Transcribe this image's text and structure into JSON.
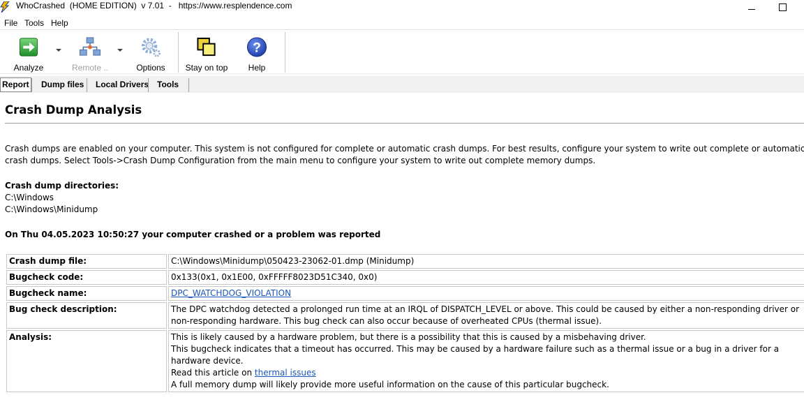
{
  "window": {
    "title": "WhoCrashed  (HOME EDITION)  v 7.01  -   https://www.resplendence.com"
  },
  "menu": [
    "File",
    "Tools",
    "Help"
  ],
  "toolbar": {
    "analyze": "Analyze",
    "remote": "Remote ..",
    "options": "Options",
    "stay_on_top": "Stay on top",
    "help": "Help"
  },
  "tabs": [
    "Report",
    "Dump files",
    "Local Drivers",
    "Tools"
  ],
  "report": {
    "heading": "Crash Dump Analysis",
    "intro": "Crash dumps are enabled on your computer. This system is not configured for complete or automatic crash dumps. For best results, configure your system to write out complete or automatic crash dumps. Select Tools->Crash Dump Configuration from the main menu to configure your system to write out complete memory dumps.",
    "dirs_title": "Crash dump directories:",
    "dirs": [
      "C:\\Windows",
      "C:\\Windows\\Minidump"
    ],
    "crash_line": "On Thu 04.05.2023 10:50:27 your computer crashed or a problem was reported",
    "table": {
      "dump_file_key": "Crash dump file:",
      "dump_file_val": "C:\\Windows\\Minidump\\050423-23062-01.dmp (Minidump)",
      "bugcheck_code_key": "Bugcheck code:",
      "bugcheck_code_val": "0x133(0x1, 0x1E00, 0xFFFFF8023D51C340, 0x0)",
      "bugcheck_name_key": "Bugcheck name:",
      "bugcheck_name_val": "DPC_WATCHDOG_VIOLATION",
      "description_key": "Bug check description:",
      "description_val": "The DPC watchdog detected a prolonged run time at an IRQL of DISPATCH_LEVEL or above. This could be caused by either a non-responding driver or non-responding hardware. This bug check can also occur because of overheated CPUs (thermal issue).",
      "analysis_key": "Analysis:",
      "analysis_line1": "This is likely caused by a hardware problem, but there is a possibility that this is caused by a misbehaving driver.",
      "analysis_line2": "This bugcheck indicates that a timeout has occurred. This may be caused by a hardware failure such as a thermal issue or a bug in a driver for a hardware device.",
      "analysis_read_prefix": "Read this article on ",
      "analysis_read_link": "thermal issues",
      "analysis_line4": "A full memory dump will likely provide more useful information on the cause of this particular bugcheck."
    }
  }
}
